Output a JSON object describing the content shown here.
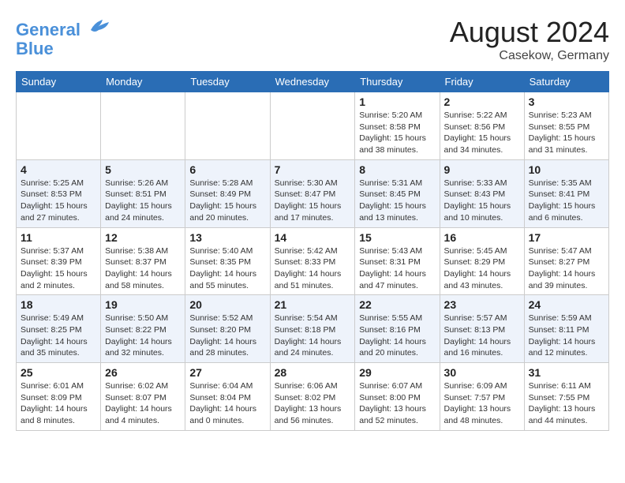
{
  "header": {
    "logo_line1": "General",
    "logo_line2": "Blue",
    "month": "August 2024",
    "location": "Casekow, Germany"
  },
  "weekdays": [
    "Sunday",
    "Monday",
    "Tuesday",
    "Wednesday",
    "Thursday",
    "Friday",
    "Saturday"
  ],
  "weeks": [
    [
      {
        "day": "",
        "info": ""
      },
      {
        "day": "",
        "info": ""
      },
      {
        "day": "",
        "info": ""
      },
      {
        "day": "",
        "info": ""
      },
      {
        "day": "1",
        "info": "Sunrise: 5:20 AM\nSunset: 8:58 PM\nDaylight: 15 hours\nand 38 minutes."
      },
      {
        "day": "2",
        "info": "Sunrise: 5:22 AM\nSunset: 8:56 PM\nDaylight: 15 hours\nand 34 minutes."
      },
      {
        "day": "3",
        "info": "Sunrise: 5:23 AM\nSunset: 8:55 PM\nDaylight: 15 hours\nand 31 minutes."
      }
    ],
    [
      {
        "day": "4",
        "info": "Sunrise: 5:25 AM\nSunset: 8:53 PM\nDaylight: 15 hours\nand 27 minutes."
      },
      {
        "day": "5",
        "info": "Sunrise: 5:26 AM\nSunset: 8:51 PM\nDaylight: 15 hours\nand 24 minutes."
      },
      {
        "day": "6",
        "info": "Sunrise: 5:28 AM\nSunset: 8:49 PM\nDaylight: 15 hours\nand 20 minutes."
      },
      {
        "day": "7",
        "info": "Sunrise: 5:30 AM\nSunset: 8:47 PM\nDaylight: 15 hours\nand 17 minutes."
      },
      {
        "day": "8",
        "info": "Sunrise: 5:31 AM\nSunset: 8:45 PM\nDaylight: 15 hours\nand 13 minutes."
      },
      {
        "day": "9",
        "info": "Sunrise: 5:33 AM\nSunset: 8:43 PM\nDaylight: 15 hours\nand 10 minutes."
      },
      {
        "day": "10",
        "info": "Sunrise: 5:35 AM\nSunset: 8:41 PM\nDaylight: 15 hours\nand 6 minutes."
      }
    ],
    [
      {
        "day": "11",
        "info": "Sunrise: 5:37 AM\nSunset: 8:39 PM\nDaylight: 15 hours\nand 2 minutes."
      },
      {
        "day": "12",
        "info": "Sunrise: 5:38 AM\nSunset: 8:37 PM\nDaylight: 14 hours\nand 58 minutes."
      },
      {
        "day": "13",
        "info": "Sunrise: 5:40 AM\nSunset: 8:35 PM\nDaylight: 14 hours\nand 55 minutes."
      },
      {
        "day": "14",
        "info": "Sunrise: 5:42 AM\nSunset: 8:33 PM\nDaylight: 14 hours\nand 51 minutes."
      },
      {
        "day": "15",
        "info": "Sunrise: 5:43 AM\nSunset: 8:31 PM\nDaylight: 14 hours\nand 47 minutes."
      },
      {
        "day": "16",
        "info": "Sunrise: 5:45 AM\nSunset: 8:29 PM\nDaylight: 14 hours\nand 43 minutes."
      },
      {
        "day": "17",
        "info": "Sunrise: 5:47 AM\nSunset: 8:27 PM\nDaylight: 14 hours\nand 39 minutes."
      }
    ],
    [
      {
        "day": "18",
        "info": "Sunrise: 5:49 AM\nSunset: 8:25 PM\nDaylight: 14 hours\nand 35 minutes."
      },
      {
        "day": "19",
        "info": "Sunrise: 5:50 AM\nSunset: 8:22 PM\nDaylight: 14 hours\nand 32 minutes."
      },
      {
        "day": "20",
        "info": "Sunrise: 5:52 AM\nSunset: 8:20 PM\nDaylight: 14 hours\nand 28 minutes."
      },
      {
        "day": "21",
        "info": "Sunrise: 5:54 AM\nSunset: 8:18 PM\nDaylight: 14 hours\nand 24 minutes."
      },
      {
        "day": "22",
        "info": "Sunrise: 5:55 AM\nSunset: 8:16 PM\nDaylight: 14 hours\nand 20 minutes."
      },
      {
        "day": "23",
        "info": "Sunrise: 5:57 AM\nSunset: 8:13 PM\nDaylight: 14 hours\nand 16 minutes."
      },
      {
        "day": "24",
        "info": "Sunrise: 5:59 AM\nSunset: 8:11 PM\nDaylight: 14 hours\nand 12 minutes."
      }
    ],
    [
      {
        "day": "25",
        "info": "Sunrise: 6:01 AM\nSunset: 8:09 PM\nDaylight: 14 hours\nand 8 minutes."
      },
      {
        "day": "26",
        "info": "Sunrise: 6:02 AM\nSunset: 8:07 PM\nDaylight: 14 hours\nand 4 minutes."
      },
      {
        "day": "27",
        "info": "Sunrise: 6:04 AM\nSunset: 8:04 PM\nDaylight: 14 hours\nand 0 minutes."
      },
      {
        "day": "28",
        "info": "Sunrise: 6:06 AM\nSunset: 8:02 PM\nDaylight: 13 hours\nand 56 minutes."
      },
      {
        "day": "29",
        "info": "Sunrise: 6:07 AM\nSunset: 8:00 PM\nDaylight: 13 hours\nand 52 minutes."
      },
      {
        "day": "30",
        "info": "Sunrise: 6:09 AM\nSunset: 7:57 PM\nDaylight: 13 hours\nand 48 minutes."
      },
      {
        "day": "31",
        "info": "Sunrise: 6:11 AM\nSunset: 7:55 PM\nDaylight: 13 hours\nand 44 minutes."
      }
    ]
  ]
}
